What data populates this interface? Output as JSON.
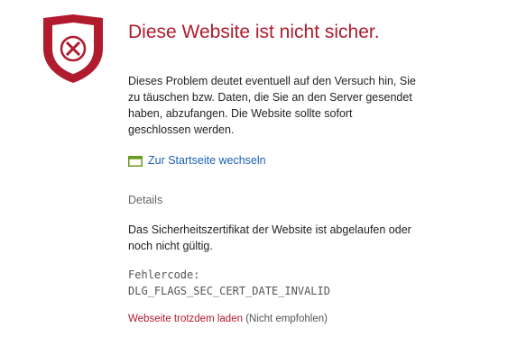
{
  "colors": {
    "title": "#b01b2e",
    "shield": "#b01b2e",
    "link": "#1a5fb4",
    "home_icon": "#6a9a1f"
  },
  "icons": {
    "warning": "shield-x-icon",
    "home": "browser-window-icon"
  },
  "title": "Diese Website ist nicht sicher.",
  "description": "Dieses Problem deutet eventuell auf den Versuch hin, Sie zu täuschen bzw. Daten, die Sie an den Server gesendet haben, abzufangen. Die Website sollte sofort geschlossen werden.",
  "home_link": "Zur Startseite wechseln",
  "details": {
    "toggle_label": "Details",
    "text": "Das Sicherheitszertifikat der Website ist abgelaufen oder noch nicht gültig.",
    "error_code_label": "Fehlercode:",
    "error_code": "DLG_FLAGS_SEC_CERT_DATE_INVALID",
    "proceed_link": "Webseite trotzdem laden",
    "proceed_note": "(Nicht empfohlen)"
  }
}
